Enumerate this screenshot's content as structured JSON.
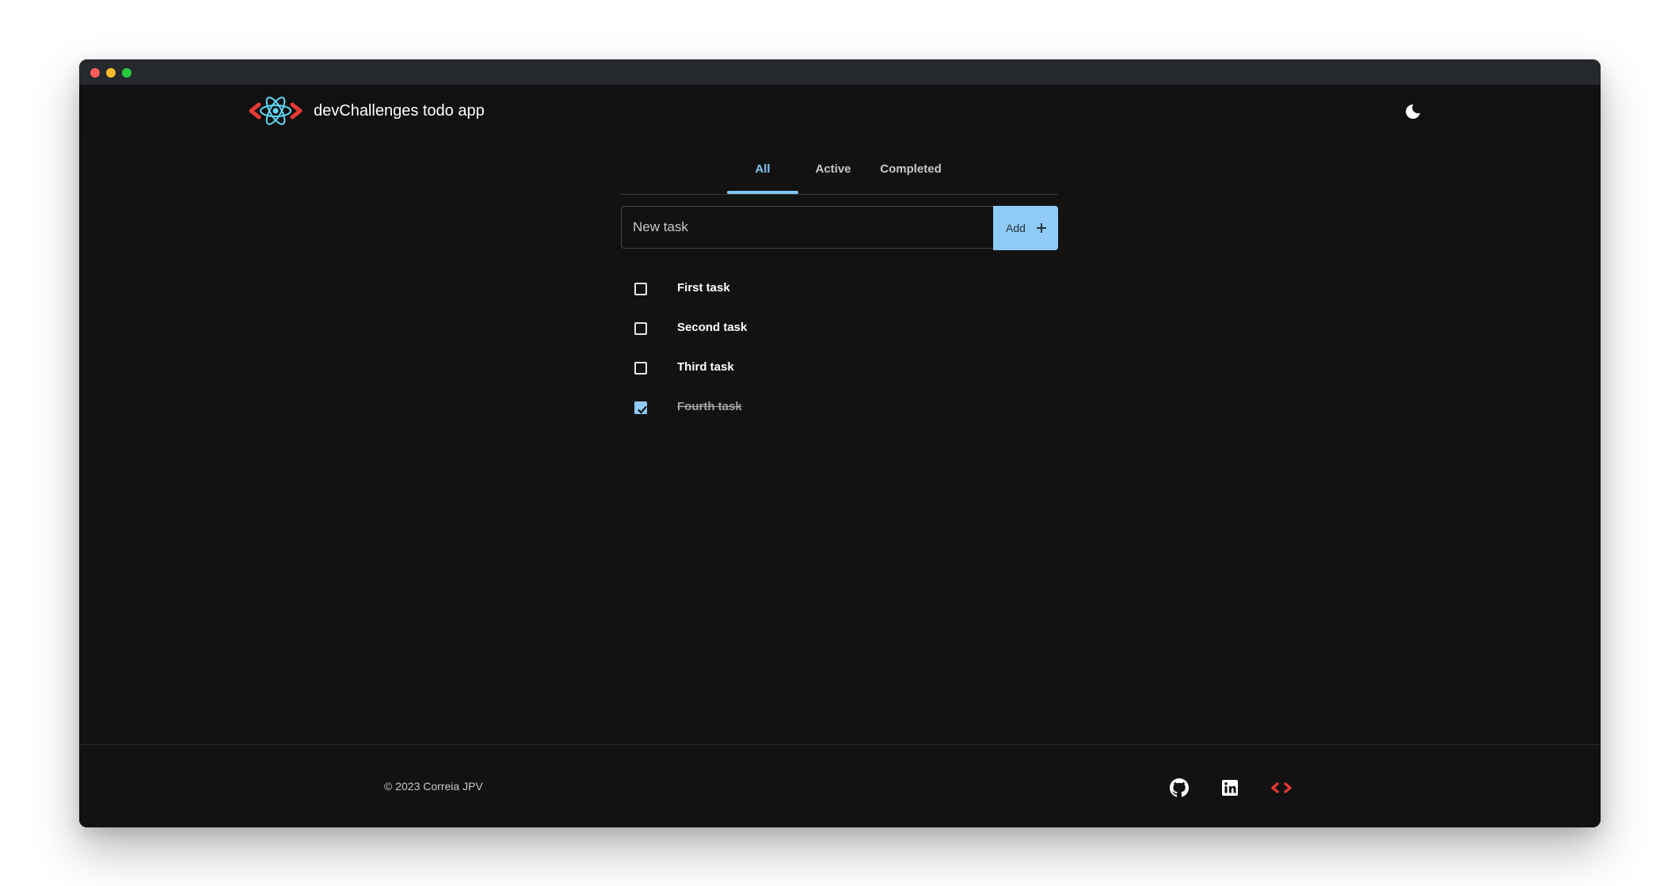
{
  "header": {
    "title": "devChallenges todo app",
    "theme_icon": "moon-icon"
  },
  "tabs": [
    {
      "label": "All",
      "active": true
    },
    {
      "label": "Active",
      "active": false
    },
    {
      "label": "Completed",
      "active": false
    }
  ],
  "new_task": {
    "placeholder": "New task",
    "value": "",
    "add_label": "Add"
  },
  "tasks": [
    {
      "label": "First task",
      "completed": false
    },
    {
      "label": "Second task",
      "completed": false
    },
    {
      "label": "Third task",
      "completed": false
    },
    {
      "label": "Fourth task",
      "completed": true
    }
  ],
  "footer": {
    "copyright": "© 2023 Correia JPV",
    "icons": [
      "github-icon",
      "linkedin-icon",
      "devchallenges-icon"
    ]
  },
  "colors": {
    "accent": "#90caf9",
    "background": "#121212",
    "brand_red": "#e53935",
    "react_blue": "#61dafb"
  }
}
